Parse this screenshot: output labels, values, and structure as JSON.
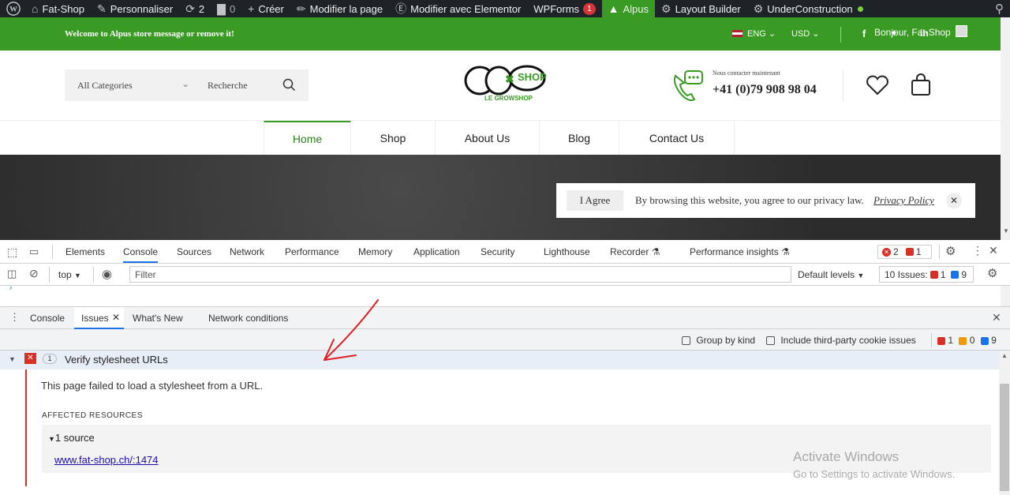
{
  "adminbar": {
    "site_name": "Fat-Shop",
    "customize": "Personnaliser",
    "updates_count": "2",
    "comments_count": "0",
    "create": "Créer",
    "edit_page": "Modifier la page",
    "edit_elementor": "Modifier avec Elementor",
    "wpforms": "WPForms",
    "wpforms_badge": "1",
    "alpus": "Alpus",
    "layout_builder": "Layout Builder",
    "under_construction": "UnderConstruction"
  },
  "topbar": {
    "welcome": "Welcome to Alpus store message or remove it!",
    "language": "ENG",
    "currency": "USD",
    "greeting": "Bonjour, Fat-Shop"
  },
  "header": {
    "category_select": "All Categories",
    "search_placeholder": "Recherche",
    "logo_text": "SHOP",
    "logo_sub": "LE GROWSHOP",
    "contact_label": "Nous contacter maintenant",
    "phone": "+41 (0)79 908 98 04"
  },
  "nav": {
    "items": [
      "Home",
      "Shop",
      "About Us",
      "Blog",
      "Contact Us"
    ]
  },
  "cookie": {
    "agree_button": "I Agree",
    "message": "By browsing this website, you agree to our privacy law.",
    "policy_link": "Privacy Policy"
  },
  "devtools": {
    "tabs": [
      "Elements",
      "Console",
      "Sources",
      "Network",
      "Performance",
      "Memory",
      "Application",
      "Security",
      "Lighthouse",
      "Recorder",
      "Performance insights"
    ],
    "active_tab": "Console",
    "error_count": "2",
    "issue_count_badge": "1",
    "context": "top",
    "filter_placeholder": "Filter",
    "levels": "Default levels",
    "issues_label": "10 Issues:",
    "issues_red": "1",
    "issues_blue": "9",
    "drawer_tabs": [
      "Console",
      "Issues",
      "What's New",
      "Network conditions"
    ],
    "group_by_kind": "Group by kind",
    "third_party": "Include third-party cookie issues",
    "count_red": "1",
    "count_orange": "0",
    "count_blue": "9",
    "issue_count": "1",
    "issue_title": "Verify stylesheet URLs",
    "issue_desc": "This page failed to load a stylesheet from a URL.",
    "affected_heading": "AFFECTED RESOURCES",
    "source_toggle": "1 source",
    "source_link": "www.fat-shop.ch/:1474",
    "watermark_title": "Activate Windows",
    "watermark_sub": "Go to Settings to activate Windows."
  },
  "colors": {
    "brand_green": "#3a9b24",
    "admin_bg": "#1d2327",
    "error_red": "#d93025",
    "annotation_red": "#e02020"
  }
}
